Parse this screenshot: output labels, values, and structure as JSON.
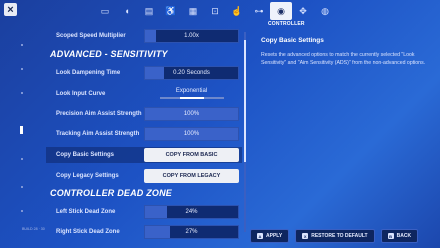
{
  "nav": {
    "close_label": "×",
    "icons": [
      {
        "name": "monitor-icon",
        "glyph": "▭"
      },
      {
        "name": "speaker-icon",
        "glyph": "◖"
      },
      {
        "name": "display-settings-icon",
        "glyph": "▤"
      },
      {
        "name": "accessibility-icon",
        "glyph": "♿"
      },
      {
        "name": "keyboard-icon",
        "glyph": "▦"
      },
      {
        "name": "mouse-icon",
        "glyph": "⊡"
      },
      {
        "name": "touch-icon",
        "glyph": "☝"
      },
      {
        "name": "network-icon",
        "glyph": "⊶"
      },
      {
        "name": "controller-icon",
        "glyph": "◉"
      },
      {
        "name": "move-icon",
        "glyph": "✥"
      },
      {
        "name": "account-icon",
        "glyph": "◍"
      }
    ],
    "active_label": "CONTROLLER"
  },
  "build_label": "BUILD 28 · 30",
  "settings": {
    "scoped_speed": {
      "label": "Scoped Speed Multiplier",
      "value": "1.00x",
      "fill_percent": 12
    },
    "advanced_heading": "ADVANCED - SENSITIVITY",
    "look_dampening": {
      "label": "Look Dampening Time",
      "value": "0.20 Seconds",
      "fill_percent": 20
    },
    "look_input_curve": {
      "label": "Look Input Curve",
      "value": "Exponential"
    },
    "precision_aim": {
      "label": "Precision Aim Assist Strength",
      "value": "100%",
      "fill_percent": 100
    },
    "tracking_aim": {
      "label": "Tracking Aim Assist Strength",
      "value": "100%",
      "fill_percent": 100
    },
    "copy_basic": {
      "label": "Copy Basic Settings",
      "button": "COPY FROM BASIC"
    },
    "copy_legacy": {
      "label": "Copy Legacy Settings",
      "button": "COPY FROM LEGACY"
    },
    "deadzone_heading": "CONTROLLER DEAD ZONE",
    "left_deadzone": {
      "label": "Left Stick Dead Zone",
      "value": "24%",
      "fill_percent": 24
    },
    "right_deadzone": {
      "label": "Right Stick Dead Zone",
      "value": "27%",
      "fill_percent": 27
    }
  },
  "info": {
    "title": "Copy Basic Settings",
    "body": "Resets the advanced options to match the currently selected \"Look Sensitivity\" and \"Aim Sensitivity (ADS)\" from the non-advanced options."
  },
  "bottom": {
    "apply": {
      "key": "A",
      "label": "APPLY"
    },
    "restore": {
      "key": "X",
      "label": "RESTORE TO DEFAULT"
    },
    "back": {
      "key": "B",
      "label": "BACK"
    }
  },
  "colors": {
    "background": "#1d52c4",
    "field": "#0f2b72",
    "fill": "#3a62c9",
    "button": "#eef0f5"
  }
}
